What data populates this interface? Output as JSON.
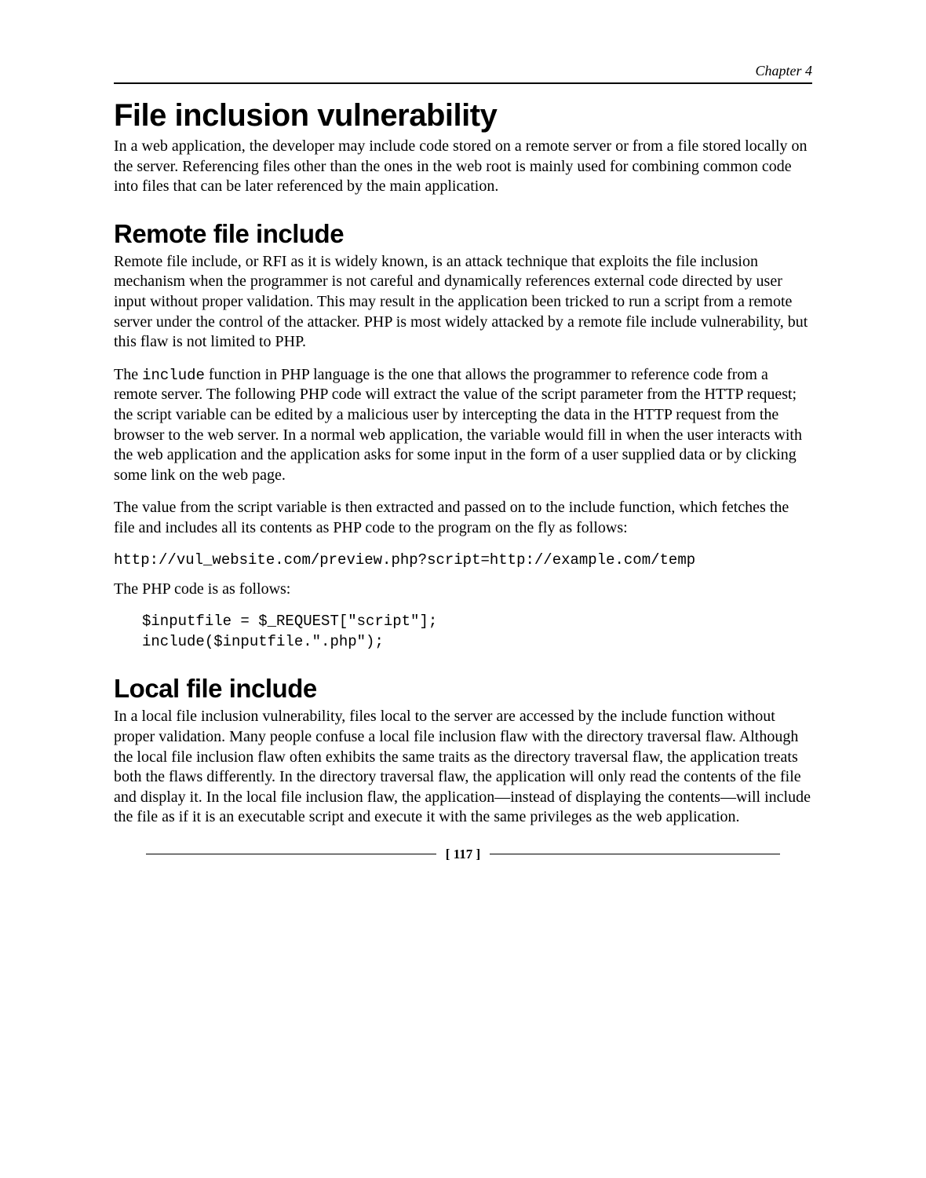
{
  "chapter": "Chapter 4",
  "h1": "File inclusion vulnerability",
  "p1": "In a web application, the developer may include code stored on a remote server or from a file stored locally on the server. Referencing files other than the ones in the web root is mainly used for combining common code into files that can be later referenced by the main application.",
  "h2a": "Remote file include",
  "p2": "Remote file include, or RFI as it is widely known, is an attack technique that exploits the file inclusion mechanism when the programmer is not careful and dynamically references external code directed by user input without proper validation. This may result in the application been tricked to run a script from a remote server under the control of the attacker. PHP is most widely attacked by a remote file include vulnerability, but this flaw is not limited to PHP.",
  "p3_a": "The ",
  "p3_code": "include",
  "p3_b": " function in PHP language is the one that allows the programmer to reference code from a remote server. The following PHP code will extract the value of the script parameter from the HTTP request; the script variable can be edited by a malicious user by intercepting the data in the HTTP request from the browser to the web server. In a normal web application, the variable would fill in when the user interacts with the web application and the application asks for some input in the form of a user supplied data or by clicking some link on the web page.",
  "p4": "The value from the script variable is then extracted and passed on to the include function, which fetches the file and includes all its contents as PHP code to the program on the fly as follows:",
  "url": "http://vul_website.com/preview.php?script=http://example.com/temp",
  "p5": "The PHP code is as follows:",
  "code": "$inputfile = $_REQUEST[\"script\"];\ninclude($inputfile.\".php\");",
  "h2b": "Local file include",
  "p6": "In a local file inclusion vulnerability, files local to the server are accessed by the include function without proper validation. Many people confuse a local file inclusion flaw with the directory traversal flaw. Although the local file inclusion flaw often exhibits the same traits as the directory traversal flaw, the application treats both the flaws differently. In the directory traversal flaw, the application will only read the contents of the file and display it. In the local file inclusion flaw, the application—instead of displaying the contents—will include the file as if it is an executable script and execute it with the same privileges as the web application.",
  "page_num": "[ 117 ]"
}
